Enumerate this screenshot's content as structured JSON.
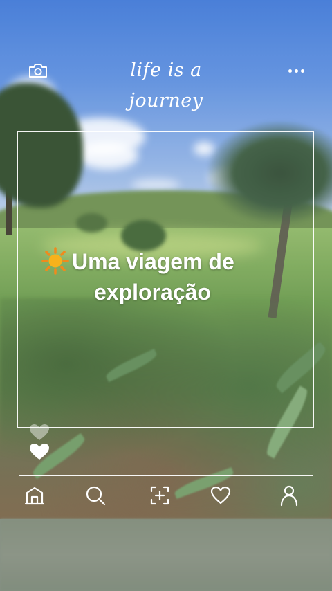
{
  "header": {
    "slogan": "life is a journey",
    "left_icon": "camera-icon",
    "right_icon": "more-dots-icon"
  },
  "post": {
    "caption_emoji": "sun-emoji",
    "caption_line1": "Uma viagem de",
    "caption_line2": "exploração"
  },
  "reactions": {
    "icons": [
      "heart-outline-icon",
      "heart-filled-icon"
    ]
  },
  "bottom_nav": {
    "items": [
      {
        "icon": "home-icon"
      },
      {
        "icon": "search-icon"
      },
      {
        "icon": "add-post-icon"
      },
      {
        "icon": "heart-icon"
      },
      {
        "icon": "profile-icon"
      }
    ]
  },
  "colors": {
    "overlay_white": "#ffffff",
    "sun_yellow": "#f7b21b",
    "sun_orange": "#f08a1c",
    "sky_blue": "#4a80d8"
  }
}
